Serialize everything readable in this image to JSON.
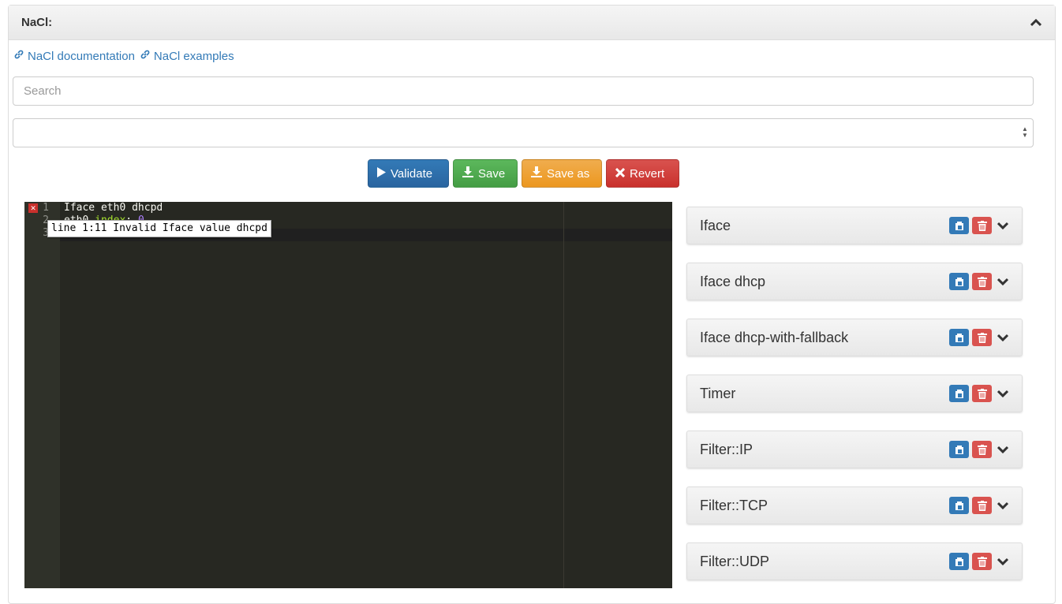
{
  "panel": {
    "title": "NaCl:",
    "links": [
      {
        "label": "NaCl documentation"
      },
      {
        "label": "NaCl examples"
      }
    ],
    "search": {
      "placeholder": "Search",
      "value": ""
    },
    "select": {
      "value": ""
    }
  },
  "toolbar": {
    "validate_label": "Validate",
    "save_label": "Save",
    "save_as_label": "Save as",
    "revert_label": "Revert"
  },
  "editor": {
    "line_numbers": [
      "1",
      "2",
      "3"
    ],
    "line1": "Iface eth0 dhcpd",
    "line2_key": "eth0",
    "line2_prop": ".index",
    "line2_colon": ":",
    "line2_value": "0",
    "error_tooltip": "line 1:11 Invalid Iface value dhcpd"
  },
  "examples": [
    {
      "title": "Iface"
    },
    {
      "title": "Iface dhcp"
    },
    {
      "title": "Iface dhcp-with-fallback"
    },
    {
      "title": "Timer"
    },
    {
      "title": "Filter::IP"
    },
    {
      "title": "Filter::TCP"
    },
    {
      "title": "Filter::UDP"
    }
  ],
  "colors": {
    "primary": "#337ab7",
    "success": "#5cb85c",
    "warning": "#f0ad4e",
    "danger": "#d9534f",
    "editor_bg": "#272822"
  }
}
